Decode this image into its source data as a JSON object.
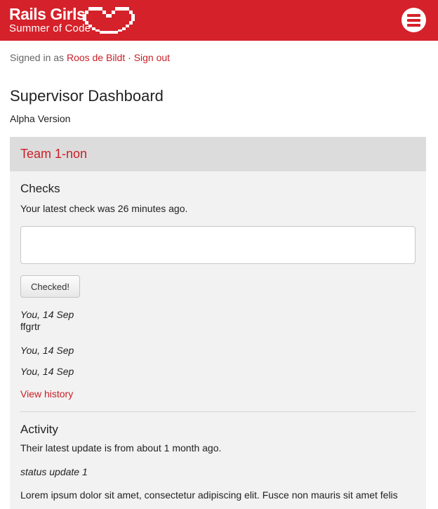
{
  "header": {
    "brand_title": "Rails Girls",
    "brand_subtitle": "Summer of Code",
    "logo_icon": "pixel-heart-icon",
    "menu_icon": "hamburger-menu-icon",
    "brand_color": "#d5212a"
  },
  "session": {
    "prefix": "Signed in as ",
    "user": "Roos de Bildt",
    "separator": " · ",
    "signout": "Sign out"
  },
  "page": {
    "title": "Supervisor Dashboard",
    "version": "Alpha Version"
  },
  "team": {
    "name": "Team 1-non",
    "checks": {
      "heading": "Checks",
      "latest": "Your latest check was 26 minutes ago.",
      "input_value": "",
      "button_label": "Checked!",
      "entries": [
        {
          "meta": "You, 14 Sep",
          "note": "ffgrtr"
        },
        {
          "meta": "You, 14 Sep",
          "note": ""
        },
        {
          "meta": "You, 14 Sep",
          "note": ""
        }
      ],
      "history_link": "View history"
    },
    "activity": {
      "heading": "Activity",
      "latest": "Their latest update is from about 1 month ago.",
      "update_title": "status update 1",
      "update_body": "Lorem ipsum dolor sit amet, consectetur adipiscing elit. Fusce non mauris sit amet felis"
    }
  }
}
